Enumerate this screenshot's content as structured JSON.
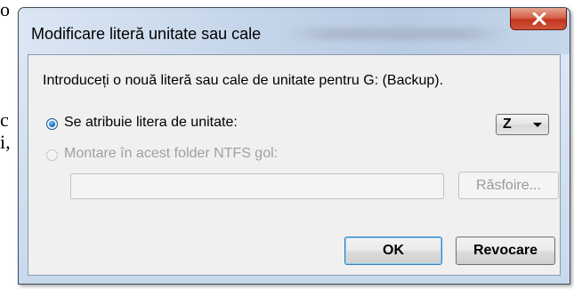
{
  "background": {
    "fragments": [
      "o",
      "c",
      "i,"
    ]
  },
  "dialog": {
    "title": "Modificare literă unitate sau cale",
    "close_icon": "close-icon",
    "instruction": "Introduceți o nouă literă sau cale de unitate pentru G: (Backup).",
    "options": [
      {
        "label": "Se atribuie litera de unitate:",
        "selected": true,
        "enabled": true
      },
      {
        "label": "Montare în acest folder NTFS gol:",
        "selected": false,
        "enabled": false
      }
    ],
    "drive_letter": {
      "value": "Z"
    },
    "path_field": {
      "value": ""
    },
    "browse_label": "Răsfoire...",
    "ok_label": "OK",
    "cancel_label": "Revocare"
  },
  "colors": {
    "close_button": "#c2351e",
    "radio_selected": "#1768c9",
    "default_button_border": "#3c7fb1"
  }
}
